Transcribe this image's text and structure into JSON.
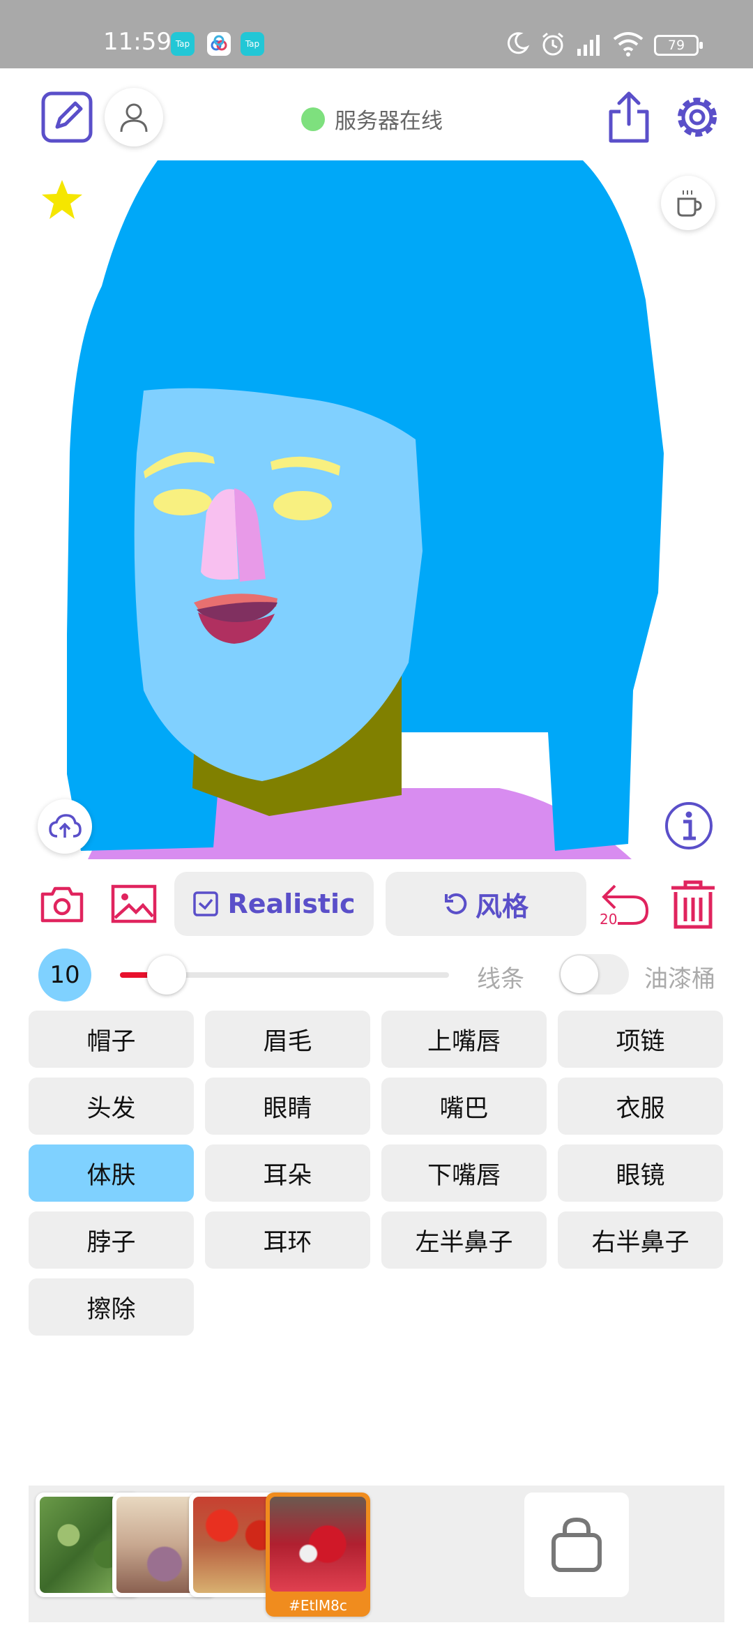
{
  "status_bar": {
    "time": "11:59",
    "tap_label": "Tap",
    "battery": "79"
  },
  "header": {
    "server_status": "服务器在线"
  },
  "actions": {
    "realistic_label": "Realistic",
    "style_label": "风格",
    "undo_count": "20"
  },
  "brush": {
    "size": "10",
    "size_fraction": 0.1,
    "line_label": "线条",
    "bucket_label": "油漆桶",
    "bucket_enabled": false
  },
  "categories": [
    {
      "label": "帽子"
    },
    {
      "label": "眉毛"
    },
    {
      "label": "上嘴唇"
    },
    {
      "label": "项链"
    },
    {
      "label": "头发"
    },
    {
      "label": "眼睛"
    },
    {
      "label": "嘴巴"
    },
    {
      "label": "衣服"
    },
    {
      "label": "体肤",
      "selected": true
    },
    {
      "label": "耳朵"
    },
    {
      "label": "下嘴唇"
    },
    {
      "label": "眼镜"
    },
    {
      "label": "脖子"
    },
    {
      "label": "耳环"
    },
    {
      "label": "左半鼻子"
    },
    {
      "label": "右半鼻子"
    },
    {
      "label": "擦除"
    }
  ],
  "palette": {
    "selected_code": "#EtlM8c"
  },
  "colors": {
    "accent": "#5a4fc9",
    "danger": "#e0245e",
    "selected_category": "#7fd1ff",
    "hair": "#00a8f8",
    "skin": "#80d0ff",
    "neck": "#808000",
    "clothes": "#d88cf0",
    "nose": "#f0a0e8",
    "eyes": "#f8f080"
  }
}
